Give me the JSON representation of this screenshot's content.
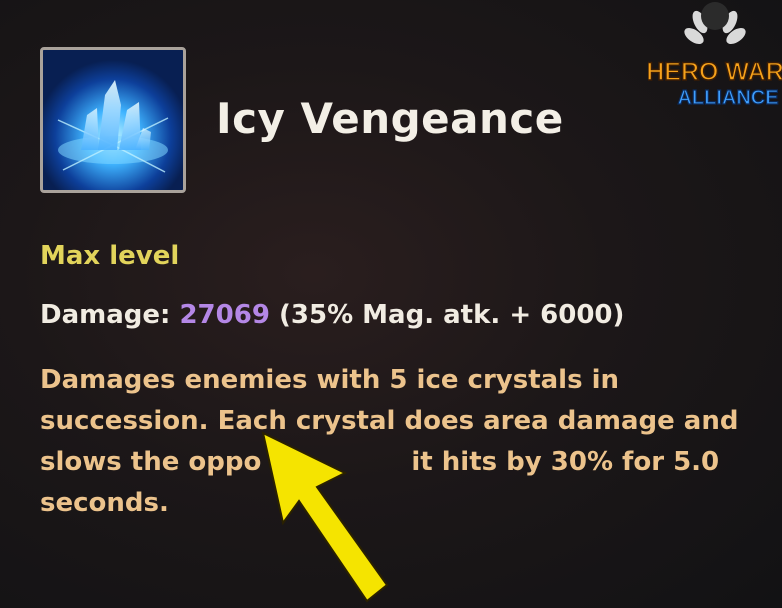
{
  "skill": {
    "icon": "ice-crystal-icon",
    "name": "Icy Vengeance",
    "level_label": "Max level",
    "damage_label": "Damage:",
    "damage_value": "27069",
    "damage_formula": "(35% Mag. atk. + 6000)",
    "description_lines": [
      "Damages enemies with 5 ice crystals in",
      "succession. Each crystal does area damage and",
      "slows the oppo",
      "seconds."
    ],
    "description_line3_tail": "it hits by 30% for 5.0"
  },
  "logo": {
    "line1": "HERO WAR",
    "line2": "ALLIANCE"
  },
  "annotation": {
    "icon": "yellow-arrow-icon",
    "color": "#f5e400"
  },
  "colors": {
    "title": "#f3efe6",
    "max_level": "#e2d45b",
    "damage_value": "#b487e6",
    "description": "#ecc38c"
  }
}
